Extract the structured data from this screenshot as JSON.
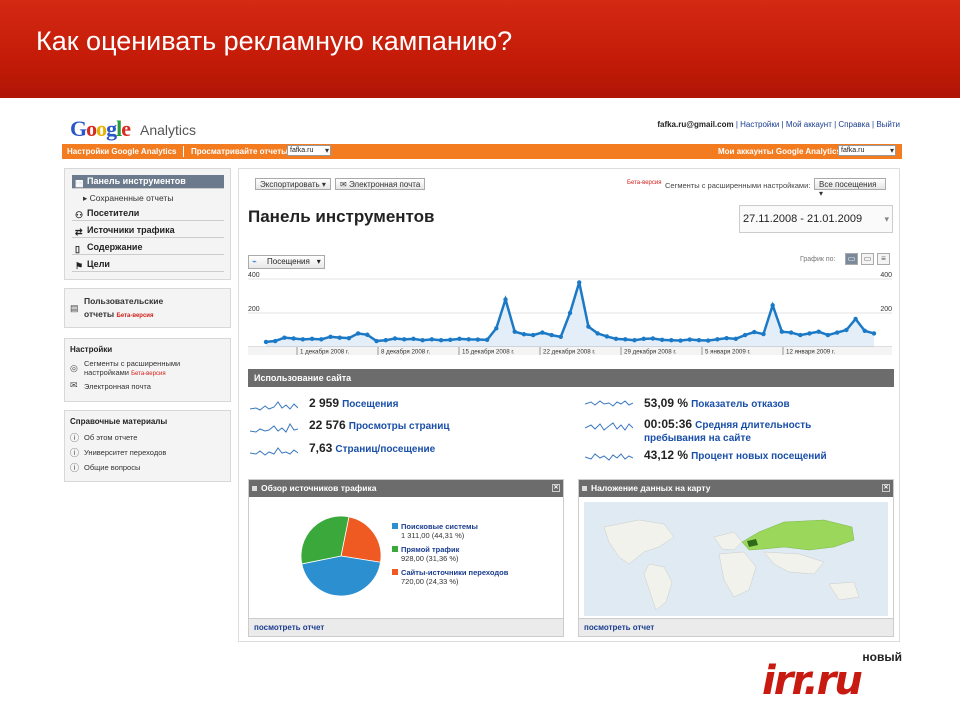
{
  "slide": {
    "title": "Как оценивать рекламную кампанию?"
  },
  "ga": {
    "logo_text": "Google",
    "product": "Analytics",
    "user_email": "fafka.ru@gmail.com",
    "top_links": [
      "Настройки",
      "Мой аккаунт",
      "Справка",
      "Выйти"
    ],
    "orange_bar": {
      "settings_link": "Настройки Google Analytics",
      "view_reports_label": "Просматривайте отчеты:",
      "view_reports_value": "fafka.ru",
      "my_accounts_label": "Мои аккаунты Google Analytics:",
      "my_accounts_value": "fafka.ru"
    },
    "sidebar": {
      "nav": [
        {
          "label": "Панель инструментов",
          "icon": "grid-icon",
          "active": true
        },
        {
          "label": "Посетители",
          "icon": "person-icon"
        },
        {
          "label": "Источники трафика",
          "icon": "traffic-icon"
        },
        {
          "label": "Содержание",
          "icon": "page-icon"
        },
        {
          "label": "Цели",
          "icon": "flag-icon"
        }
      ],
      "saved_reports": "Сохраненные отчеты",
      "custom_reports_line1": "Пользовательские",
      "custom_reports_line2": "отчеты",
      "beta": "Бета-версия",
      "settings": {
        "heading": "Настройки",
        "segments_line1": "Сегменты с расширенными",
        "segments_line2": "настройками",
        "email": "Электронная почта"
      },
      "help": {
        "heading": "Справочные материалы",
        "items": [
          "Об этом отчете",
          "Университет переходов",
          "Общие вопросы"
        ]
      }
    },
    "toolbar": {
      "export": "Экспортировать",
      "email": "Электронная почта",
      "beta": "Бета-версия",
      "segments_label": "Сегменты с расширенными настройками:",
      "segments_value": "Все посещения"
    },
    "page_title": "Панель инструментов",
    "date_range": "27.11.2008 - 21.01.2009",
    "chart_tab": "Посещения",
    "chart_type_label": "График по:",
    "chart_data": {
      "type": "area",
      "y_ticks": [
        400,
        200
      ],
      "ylim": [
        0,
        400
      ],
      "x_labels": [
        "1 декабря 2008 г.",
        "8 декабря 2008 г.",
        "15 декабря 2008 г.",
        "22 декабря 2008 г.",
        "29 декабря 2008 г.",
        "5 января 2009 г.",
        "12 января 2009 г."
      ],
      "values": [
        30,
        35,
        55,
        50,
        45,
        48,
        45,
        60,
        55,
        52,
        80,
        72,
        35,
        40,
        50,
        45,
        48,
        40,
        45,
        40,
        42,
        48,
        45,
        44,
        42,
        110,
        280,
        90,
        75,
        70,
        85,
        70,
        60,
        200,
        380,
        120,
        80,
        62,
        48,
        45,
        40,
        48,
        50,
        42,
        40,
        38,
        44,
        40,
        38,
        45,
        52,
        48,
        70,
        88,
        76,
        245,
        90,
        85,
        70,
        80,
        90,
        70,
        85,
        100,
        165,
        95,
        80
      ]
    },
    "site_usage": {
      "title": "Использование сайта",
      "left": [
        {
          "num": "2 959",
          "label": "Посещения"
        },
        {
          "num": "22 576",
          "label": "Просмотры страниц"
        },
        {
          "num": "7,63",
          "label": "Страниц/посещение"
        }
      ],
      "right": [
        {
          "num": "53,09 %",
          "label": "Показатель отказов"
        },
        {
          "num": "00:05:36",
          "label": "Средняя длительность",
          "label2": "пребывания на сайте"
        },
        {
          "num": "43,12 %",
          "label": "Процент новых посещений"
        }
      ]
    },
    "traffic": {
      "title": "Обзор источников трафика",
      "footer": "посмотреть отчет",
      "slices": [
        {
          "name": "Поисковые системы",
          "value": "1 311,00 (44,31 %)",
          "pct": 44.31,
          "color": "#2b8fd0"
        },
        {
          "name": "Прямой трафик",
          "value": "928,00 (31,36 %)",
          "pct": 31.36,
          "color": "#3aa83a"
        },
        {
          "name": "Сайты-источники переходов",
          "value": "720,00 (24,33 %)",
          "pct": 24.33,
          "color": "#ee5a22"
        }
      ]
    },
    "map": {
      "title": "Наложение данных на карту",
      "footer": "посмотреть отчет"
    }
  },
  "brand": {
    "small": "новый",
    "big": "irr.ru"
  }
}
